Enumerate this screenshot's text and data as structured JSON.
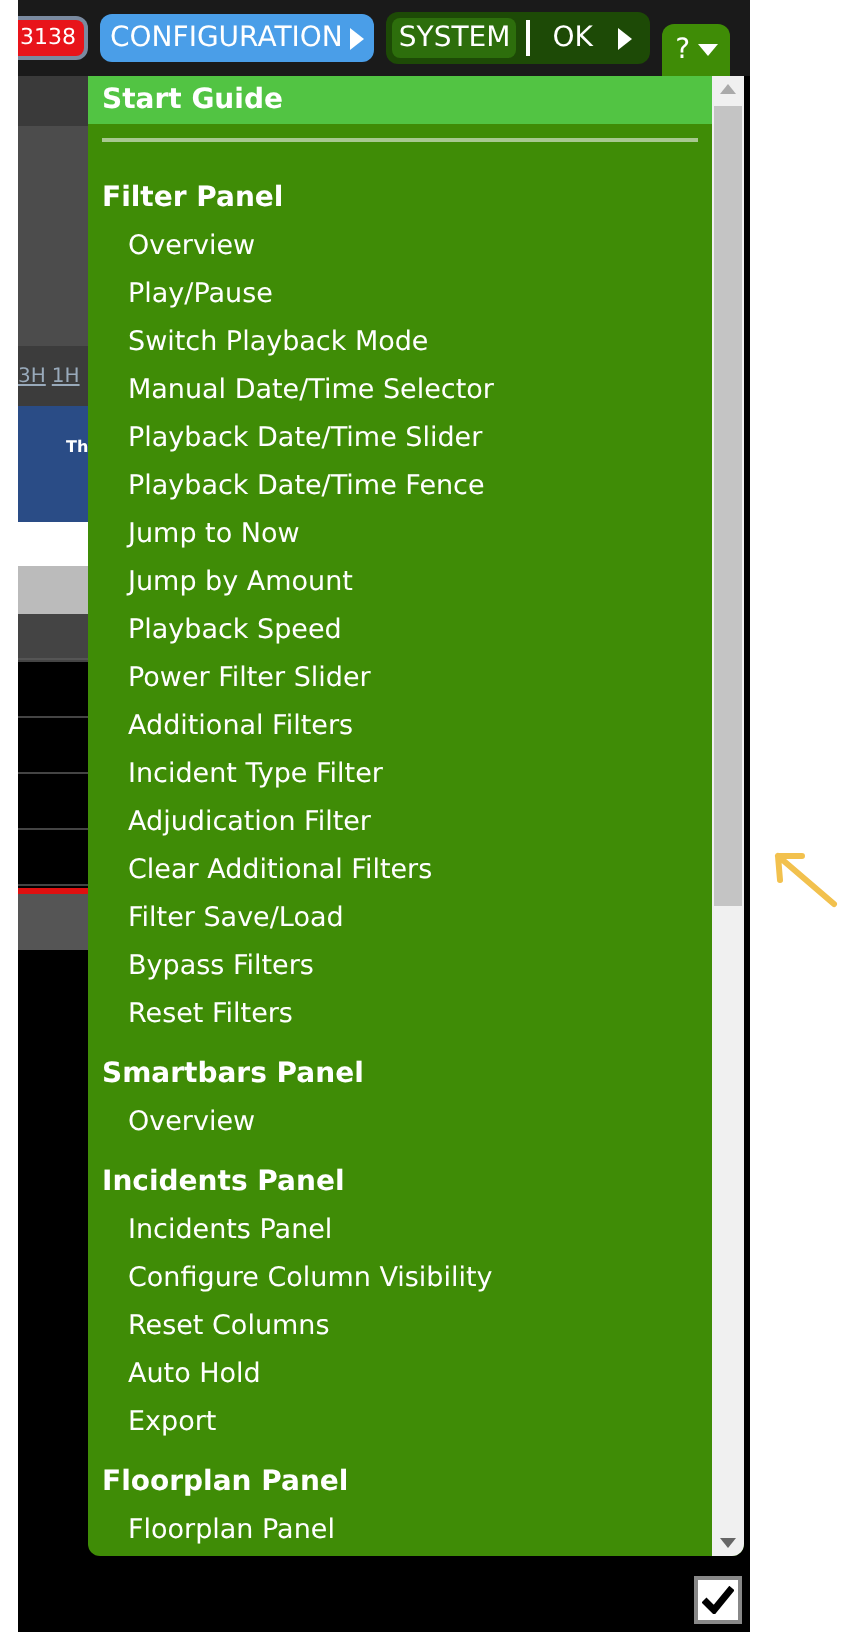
{
  "top_bar": {
    "alarm_count": "3138",
    "configuration": "CONFIGURATION",
    "system": "SYSTEM",
    "status": "OK",
    "help": "?"
  },
  "background": {
    "range_links": [
      "3H",
      "1H"
    ],
    "day_label": "Th"
  },
  "help_menu": {
    "header": "Start Guide",
    "sections": [
      {
        "title": "Filter Panel",
        "items": [
          "Overview",
          "Play/Pause",
          "Switch Playback Mode",
          "Manual Date/Time Selector",
          "Playback Date/Time Slider",
          "Playback Date/Time Fence",
          "Jump to Now",
          "Jump by Amount",
          "Playback Speed",
          "Power Filter Slider",
          "Additional Filters",
          "Incident Type Filter",
          "Adjudication Filter",
          "Clear Additional Filters",
          "Filter Save/Load",
          "Bypass Filters",
          "Reset Filters"
        ]
      },
      {
        "title": "Smartbars Panel",
        "items": [
          "Overview"
        ]
      },
      {
        "title": "Incidents Panel",
        "items": [
          "Incidents Panel",
          "Configure Column Visibility",
          "Reset Columns",
          "Auto Hold",
          "Export"
        ]
      },
      {
        "title": "Floorplan Panel",
        "items": [
          "Floorplan Panel"
        ]
      }
    ]
  },
  "checkbox": {
    "checked": true
  }
}
